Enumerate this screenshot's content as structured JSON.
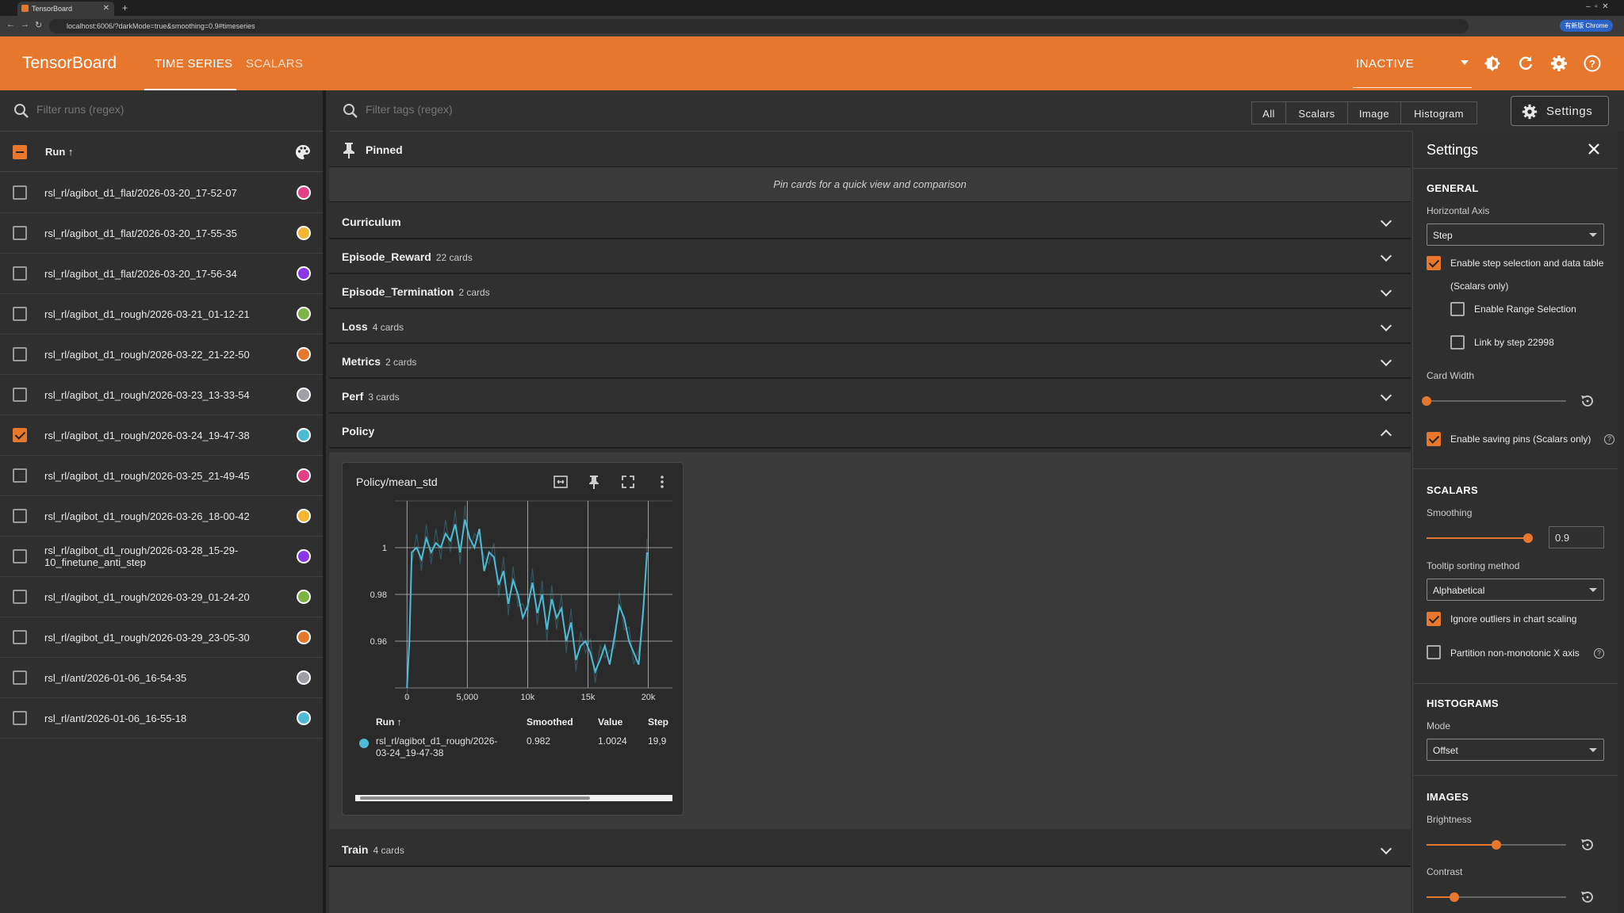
{
  "browser": {
    "tab_title": "TensorBoard",
    "url": "localhost:6006/?darkMode=true&smoothing=0.9#timeseries",
    "badge": "有新版 Chrome"
  },
  "header": {
    "brand": "TensorBoard",
    "tabs": [
      {
        "label": "TIME SERIES",
        "active": true
      },
      {
        "label": "SCALARS",
        "active": false
      }
    ],
    "plugin_select": "INACTIVE",
    "icons": [
      "theme-icon",
      "refresh-icon",
      "settings-gear-icon",
      "help-icon"
    ],
    "accent_color": "#e8772e"
  },
  "runs": {
    "filter_placeholder": "Filter runs (regex)",
    "header_label": "Run ↑",
    "items": [
      {
        "name": "rsl_rl/agibot_d1_flat/2026-03-20_17-52-07",
        "checked": false,
        "color": "#e23f84"
      },
      {
        "name": "rsl_rl/agibot_d1_flat/2026-03-20_17-55-35",
        "checked": false,
        "color": "#f5b431"
      },
      {
        "name": "rsl_rl/agibot_d1_flat/2026-03-20_17-56-34",
        "checked": false,
        "color": "#8a35e8"
      },
      {
        "name": "rsl_rl/agibot_d1_rough/2026-03-21_01-12-21",
        "checked": false,
        "color": "#7cb342"
      },
      {
        "name": "rsl_rl/agibot_d1_rough/2026-03-22_21-22-50",
        "checked": false,
        "color": "#e8772e"
      },
      {
        "name": "rsl_rl/agibot_d1_rough/2026-03-23_13-33-54",
        "checked": false,
        "color": "#9e9ea6"
      },
      {
        "name": "rsl_rl/agibot_d1_rough/2026-03-24_19-47-38",
        "checked": true,
        "color": "#4dbbd5"
      },
      {
        "name": "rsl_rl/agibot_d1_rough/2026-03-25_21-49-45",
        "checked": false,
        "color": "#e23f84"
      },
      {
        "name": "rsl_rl/agibot_d1_rough/2026-03-26_18-00-42",
        "checked": false,
        "color": "#f5b431"
      },
      {
        "name": "rsl_rl/agibot_d1_rough/2026-03-28_15-29-10_finetune_anti_step",
        "name_line1": "rsl_rl/agibot_d1_rough/2026-03-28_15-29-",
        "name_line2": "10_finetune_anti_step",
        "checked": false,
        "color": "#8a35e8"
      },
      {
        "name": "rsl_rl/agibot_d1_rough/2026-03-29_01-24-20",
        "checked": false,
        "color": "#7cb342"
      },
      {
        "name": "rsl_rl/agibot_d1_rough/2026-03-29_23-05-30",
        "checked": false,
        "color": "#e8772e"
      },
      {
        "name": "rsl_rl/ant/2026-01-06_16-54-35",
        "checked": false,
        "color": "#9e9ea6"
      },
      {
        "name": "rsl_rl/ant/2026-01-06_16-55-18",
        "checked": false,
        "color": "#4dbbd5"
      }
    ]
  },
  "main": {
    "filter_placeholder": "Filter tags (regex)",
    "type_filters": [
      "All",
      "Scalars",
      "Image",
      "Histogram"
    ],
    "settings_button": "Settings",
    "pinned_label": "Pinned",
    "pinned_message": "Pin cards for a quick view and comparison",
    "groups": [
      {
        "name": "Curriculum",
        "count": "",
        "expanded": false
      },
      {
        "name": "Episode_Reward",
        "count": "22 cards",
        "expanded": false
      },
      {
        "name": "Episode_Termination",
        "count": "2 cards",
        "expanded": false
      },
      {
        "name": "Loss",
        "count": "4 cards",
        "expanded": false
      },
      {
        "name": "Metrics",
        "count": "2 cards",
        "expanded": false
      },
      {
        "name": "Perf",
        "count": "3 cards",
        "expanded": false
      },
      {
        "name": "Policy",
        "count": "",
        "expanded": true
      },
      {
        "name": "Train",
        "count": "4 cards",
        "expanded": false
      }
    ],
    "card": {
      "title": "Policy/mean_std",
      "table_headers": [
        "Run ↑",
        "Smoothed",
        "Value",
        "Step"
      ],
      "row": {
        "run_line1": "rsl_rl/agibot_d1_rough/2026-",
        "run_line2": "03-24_19-47-38",
        "smoothed": "0.982",
        "value": "1.0024",
        "step": "19,9"
      }
    }
  },
  "chart_data": {
    "type": "line",
    "title": "Policy/mean_std",
    "xlabel": "",
    "ylabel": "",
    "x_tick_labels": [
      "0",
      "5,000",
      "10k",
      "15k",
      "20k"
    ],
    "y_tick_labels": [
      "0.96",
      "0.98",
      "1"
    ],
    "xlim": [
      -1000,
      22000
    ],
    "ylim": [
      0.94,
      1.02
    ],
    "grid": true,
    "series": [
      {
        "color": "#4dbbd5",
        "x": [
          0,
          200,
          400,
          800,
          1200,
          1600,
          2000,
          2400,
          2800,
          3200,
          3600,
          4000,
          4400,
          4800,
          5200,
          5600,
          6000,
          6400,
          6800,
          7200,
          7600,
          8000,
          8400,
          8800,
          9200,
          9600,
          10000,
          10400,
          10800,
          11200,
          11600,
          12000,
          12400,
          12800,
          13200,
          13600,
          14000,
          14400,
          14800,
          15200,
          15600,
          16000,
          16400,
          16800,
          17200,
          17600,
          18000,
          18400,
          18800,
          19200,
          19600,
          19900
        ],
        "y": [
          0.94,
          0.96,
          0.998,
          1.0,
          0.995,
          1.004,
          0.998,
          1.002,
          1.0,
          1.006,
          1.003,
          1.01,
          0.998,
          1.012,
          1.004,
          1.0,
          1.008,
          0.99,
          0.998,
          0.996,
          0.984,
          0.99,
          0.976,
          0.986,
          0.98,
          0.97,
          0.975,
          0.985,
          0.972,
          0.98,
          0.965,
          0.978,
          0.97,
          0.974,
          0.96,
          0.968,
          0.952,
          0.958,
          0.96,
          0.955,
          0.947,
          0.952,
          0.958,
          0.95,
          0.962,
          0.975,
          0.97,
          0.96,
          0.955,
          0.95,
          0.975,
          0.998
        ]
      }
    ]
  },
  "settings": {
    "title": "Settings",
    "general": {
      "heading": "GENERAL",
      "horizontal_axis_label": "Horizontal Axis",
      "horizontal_axis_value": "Step",
      "step_selection_label": "Enable step selection and data table",
      "step_selection_sub": "(Scalars only)",
      "step_selection_checked": true,
      "range_selection_label": "Enable Range Selection",
      "range_selection_checked": false,
      "link_by_step_label": "Link by step 22998",
      "link_by_step_checked": false,
      "card_width_label": "Card Width",
      "card_width_fraction": 0.0,
      "saving_pins_label": "Enable saving pins (Scalars only)",
      "saving_pins_checked": true
    },
    "scalars": {
      "heading": "SCALARS",
      "smoothing_label": "Smoothing",
      "smoothing_value": "0.9",
      "smoothing_fraction": 0.9,
      "tooltip_label": "Tooltip sorting method",
      "tooltip_value": "Alphabetical",
      "ignore_outliers_label": "Ignore outliers in chart scaling",
      "ignore_outliers_checked": true,
      "partition_label": "Partition non-monotonic X axis",
      "partition_checked": false
    },
    "histograms": {
      "heading": "HISTOGRAMS",
      "mode_label": "Mode",
      "mode_value": "Offset"
    },
    "images": {
      "heading": "IMAGES",
      "brightness_label": "Brightness",
      "brightness_fraction": 0.5,
      "contrast_label": "Contrast",
      "contrast_fraction": 0.2
    }
  }
}
